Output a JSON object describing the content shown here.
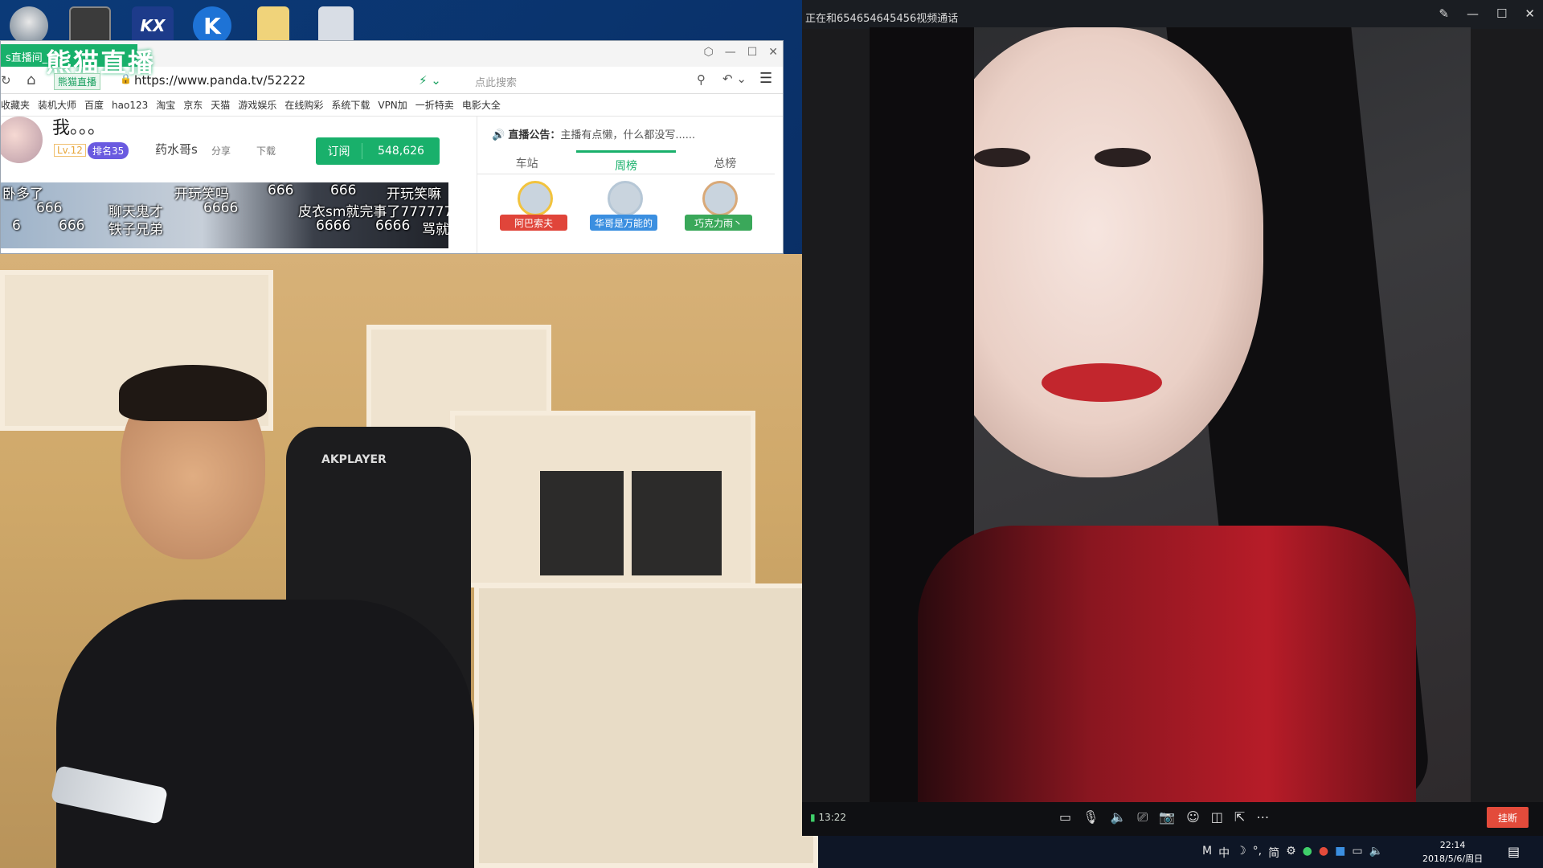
{
  "desktop": {
    "icons": [
      {
        "name": "app-icon-1",
        "glyph": ""
      },
      {
        "name": "app-icon-2",
        "glyph": ""
      },
      {
        "name": "kx-icon",
        "glyph": "KX"
      },
      {
        "name": "k-icon",
        "glyph": "K"
      },
      {
        "name": "folder-icon",
        "glyph": ""
      },
      {
        "name": "recycle-bin-icon",
        "glyph": ""
      }
    ]
  },
  "browser": {
    "tab_label": "s直播间_熊",
    "logo_text": "熊猫直播",
    "address": {
      "tag": "熊猫直播",
      "url": "https://www.panda.tv/52222",
      "search_placeholder": "点此搜索"
    },
    "bookmarks": [
      "收藏夹",
      "装机大师",
      "百度",
      "hao123",
      "淘宝",
      "京东",
      "天猫",
      "游戏娱乐",
      "在线购彩",
      "系统下载",
      "VPN加",
      "一折特卖",
      "电影大全"
    ],
    "room": {
      "title": "我。。。",
      "level": "Lv.12",
      "rank": "排名35",
      "host": "药水哥s",
      "share": "分享",
      "download": "下载",
      "subscribe_label": "订阅",
      "subscribe_count": "548,626"
    },
    "danmu": [
      "卧多了",
      "666",
      "开玩笑吗",
      "666",
      "666",
      "开玩笑嘛",
      "聊天鬼才",
      "6666",
      "皮衣sm就完事了777777",
      "666",
      "铁子兄弟",
      "6666",
      "6666",
      "骂就",
      "6"
    ],
    "sidebar": {
      "notice_label": "直播公告：",
      "notice_text": "主播有点懒，什么都没写......",
      "tabs": [
        "车站",
        "周榜",
        "总榜"
      ],
      "active_tab": "周榜",
      "ranking": [
        {
          "place": "1",
          "name": "阿巴索夫"
        },
        {
          "place": "2",
          "name": "华哥是万能的"
        },
        {
          "place": "3",
          "name": "巧克力雨丶"
        }
      ]
    }
  },
  "webcam": {
    "chair_label": "AKPLAYER"
  },
  "call": {
    "title": "正在和654654645456视频通话",
    "timer": "13:22",
    "hangup_label": "挂断"
  },
  "taskbar": {
    "tray": [
      "M",
      "中",
      "☽",
      "°,",
      "简",
      "⚙"
    ],
    "time": "22:14",
    "date": "2018/5/6/周日"
  },
  "colors": {
    "panda_green": "#19b06b",
    "hangup_red": "#e34b3b",
    "desktop_blue": "#0b3a78"
  }
}
